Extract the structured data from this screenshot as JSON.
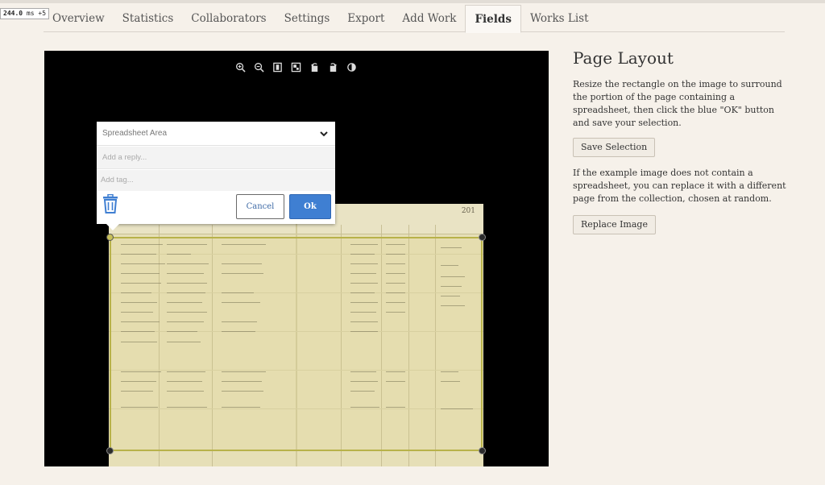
{
  "perf_badge": {
    "value": "244.0",
    "unit": "ms",
    "suffix": "+5"
  },
  "tabs": [
    {
      "label": "Overview"
    },
    {
      "label": "Statistics"
    },
    {
      "label": "Collaborators"
    },
    {
      "label": "Settings"
    },
    {
      "label": "Export"
    },
    {
      "label": "Add Work"
    },
    {
      "label": "Fields"
    },
    {
      "label": "Works List"
    }
  ],
  "active_tab": "Fields",
  "viewer": {
    "toolbar_icons": [
      "zoom-in-icon",
      "zoom-out-icon",
      "full-page-icon",
      "fit-icon",
      "rotate-left-icon",
      "rotate-right-icon",
      "contrast-icon"
    ],
    "annotation": {
      "type_value": "Spreadsheet Area",
      "reply_placeholder": "Add a reply...",
      "tag_placeholder": "Add tag...",
      "cancel_label": "Cancel",
      "ok_label": "Ok"
    },
    "page_number": "201"
  },
  "side_panel": {
    "title": "Page Layout",
    "instructions": "Resize the rectangle on the image to surround the portion of the page containing a spreadsheet, then click the blue \"OK\" button and save your selection.",
    "save_label": "Save Selection",
    "replace_text": "If the example image does not contain a spreadsheet, you can replace it with a different page from the collection, chosen at random.",
    "replace_label": "Replace Image"
  },
  "colors": {
    "ok_button": "#3f7fd2",
    "selection_border": "#b8b24a",
    "background": "#f6f1ea"
  }
}
